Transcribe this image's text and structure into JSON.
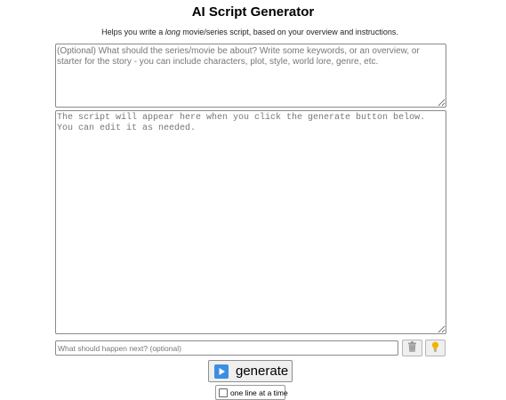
{
  "header": {
    "title": "AI Script Generator",
    "subtitle_before": "Helps you write a ",
    "subtitle_emphasis": "long",
    "subtitle_after": " movie/series script, based on your overview and instructions."
  },
  "overview_field": {
    "value": "",
    "placeholder": "(Optional) What should the series/movie be about? Write some keywords, or an overview, or starter for the story - you can include characters, plot, style, world lore, genre, etc."
  },
  "script_field": {
    "value": "",
    "placeholder": "The script will appear here when you click the generate button below. You can edit it as needed."
  },
  "next_field": {
    "value": "",
    "placeholder": "What should happen next? (optional)"
  },
  "icons": {
    "trash": "trash-icon",
    "hint": "lightbulb-icon",
    "play": "play-icon",
    "play_color": "#3d8ee0",
    "hint_color": "#f0b400"
  },
  "generate_button": {
    "label": "generate"
  },
  "one_line_option": {
    "label": "one line at a time",
    "checked": false
  }
}
